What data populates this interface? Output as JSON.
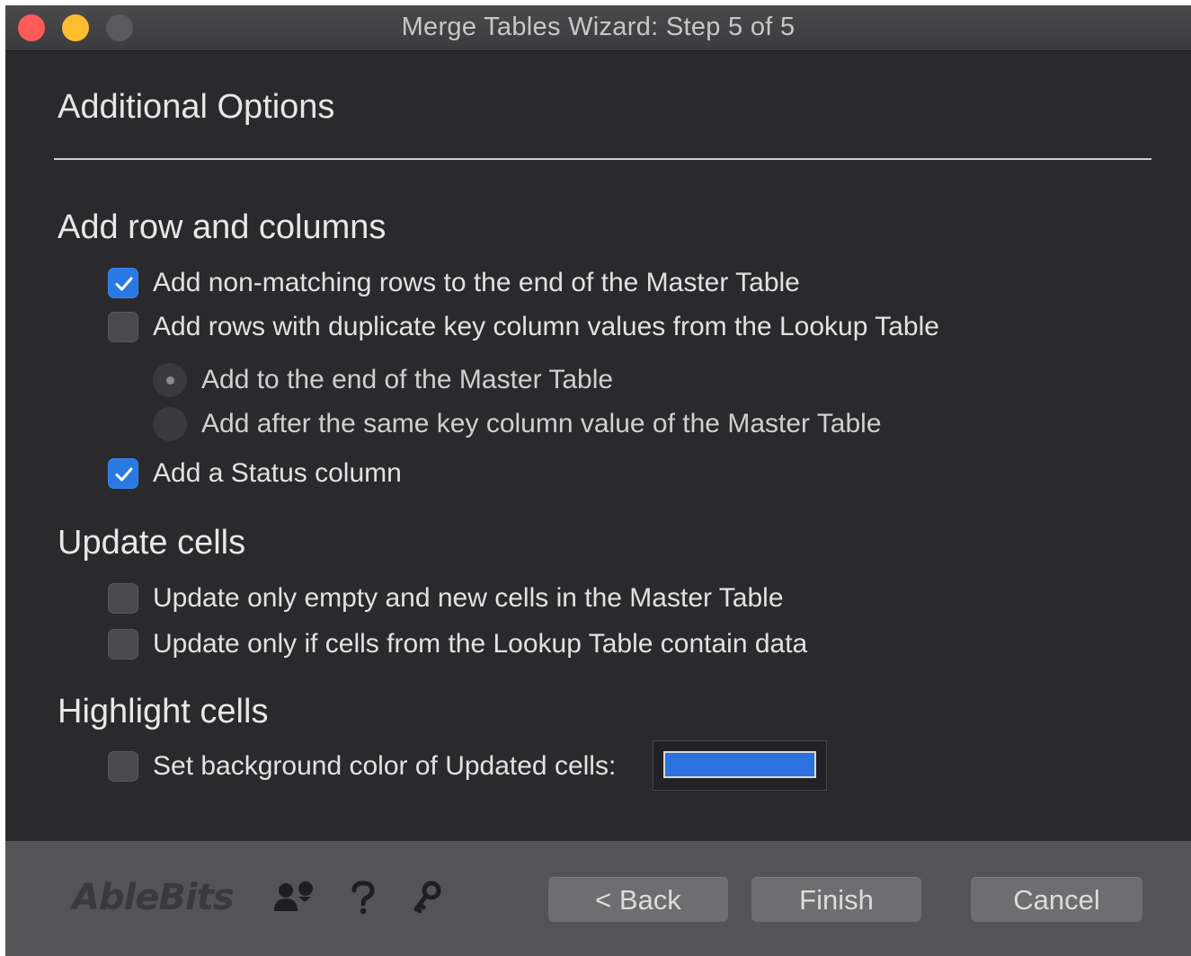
{
  "window": {
    "title": "Merge Tables Wizard: Step 5 of 5"
  },
  "page": {
    "title": "Additional Options"
  },
  "sections": {
    "add_rows": {
      "heading": "Add row and columns",
      "opt_nonmatching": {
        "label": "Add non-matching rows to the end of the Master Table",
        "checked": true
      },
      "opt_duplicates": {
        "label": "Add rows with duplicate key column values from the Lookup Table",
        "checked": false
      },
      "radio_end": {
        "label": "Add to the end of the Master Table",
        "selected": true,
        "enabled": false
      },
      "radio_after": {
        "label": "Add after the same key column value of the Master Table",
        "selected": false,
        "enabled": false
      },
      "opt_status": {
        "label": "Add a Status column",
        "checked": true
      }
    },
    "update_cells": {
      "heading": "Update cells",
      "opt_empty": {
        "label": "Update only empty and new cells in the Master Table",
        "checked": false
      },
      "opt_data": {
        "label": "Update only if cells from the Lookup Table contain data",
        "checked": false
      }
    },
    "highlight": {
      "heading": "Highlight cells",
      "opt_bg": {
        "label": "Set background color of Updated cells:",
        "checked": false
      },
      "swatch_color": "#2b72e0"
    }
  },
  "footer": {
    "logo": "AbleBits",
    "icons": [
      "community-icon",
      "help-icon",
      "key-icon"
    ],
    "back_label": "< Back",
    "finish_label": "Finish",
    "cancel_label": "Cancel"
  },
  "colors": {
    "accent": "#2a79e3",
    "traffic_close": "#fc5b56",
    "traffic_min": "#fdbd2f"
  }
}
